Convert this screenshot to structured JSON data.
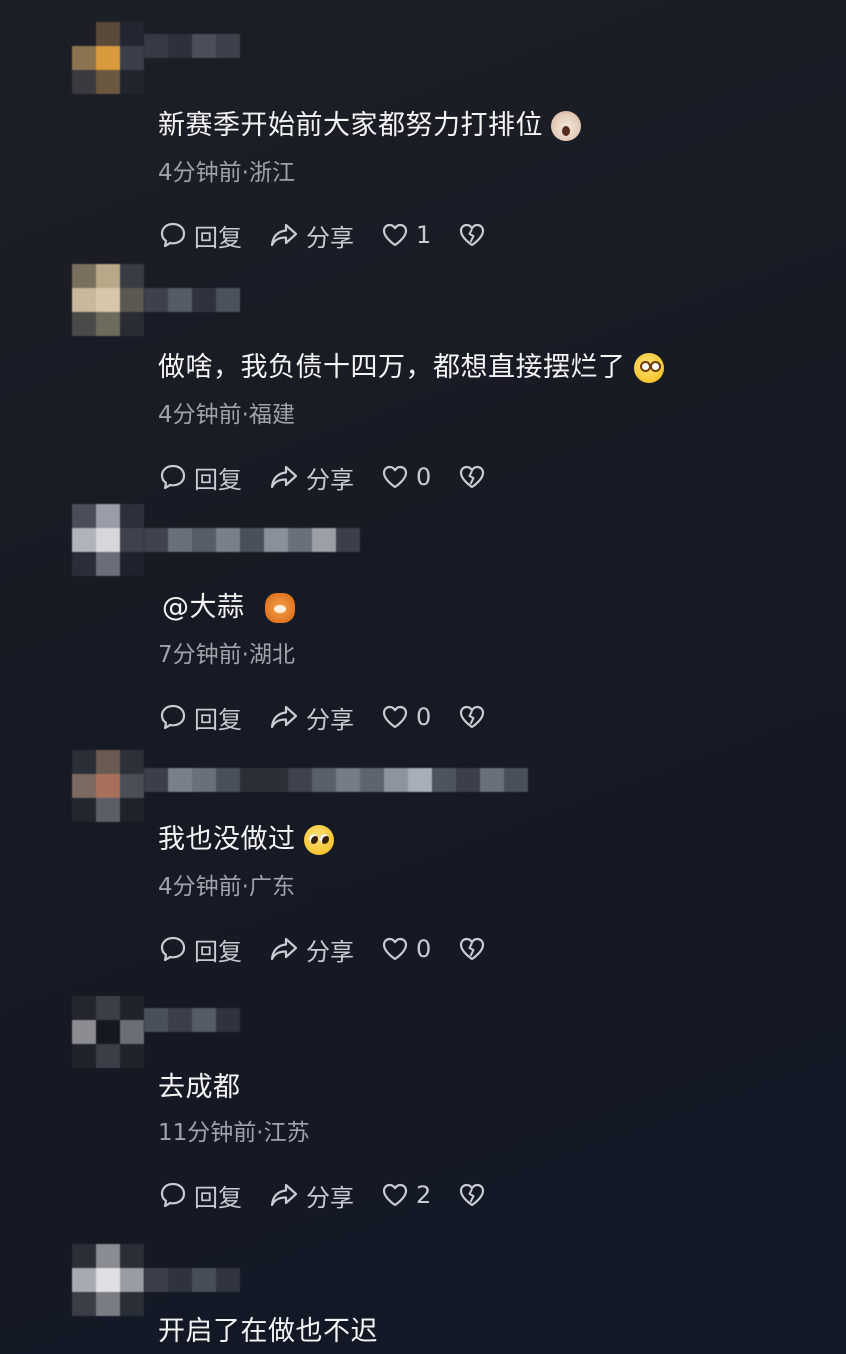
{
  "comments": [
    {
      "text": "新赛季开始前大家都努力打排位",
      "emoji": "shocked-cat-face",
      "time": "4分钟前",
      "sep": "·",
      "location": "浙江",
      "reply_label": "回复",
      "share_label": "分享",
      "likes": "1"
    },
    {
      "text": "做啥，我负债十四万，都想直接摆烂了",
      "emoji": "eye-roll-face",
      "time": "4分钟前",
      "sep": "·",
      "location": "福建",
      "reply_label": "回复",
      "share_label": "分享",
      "likes": "0"
    },
    {
      "text": "@大蒜",
      "emoji": "tiger-face",
      "time": "7分钟前",
      "sep": "·",
      "location": "湖北",
      "reply_label": "回复",
      "share_label": "分享",
      "likes": "0"
    },
    {
      "text": "我也没做过",
      "emoji": "pleading-face",
      "time": "4分钟前",
      "sep": "·",
      "location": "广东",
      "reply_label": "回复",
      "share_label": "分享",
      "likes": "0"
    },
    {
      "text": "去成都",
      "emoji": "",
      "time": "11分钟前",
      "sep": "·",
      "location": "江苏",
      "reply_label": "回复",
      "share_label": "分享",
      "likes": "2"
    },
    {
      "text": "开启了在做也不迟",
      "emoji": "",
      "time": "",
      "sep": "",
      "location": "",
      "reply_label": "",
      "share_label": "",
      "likes": ""
    }
  ],
  "colors": {
    "background": "#171b25",
    "text": "#f4f4f4",
    "meta": "#9ea2ab",
    "action": "#c8cbd2"
  },
  "icons": [
    "reply-bubble-icon",
    "share-arrow-icon",
    "heart-icon",
    "broken-heart-icon"
  ]
}
